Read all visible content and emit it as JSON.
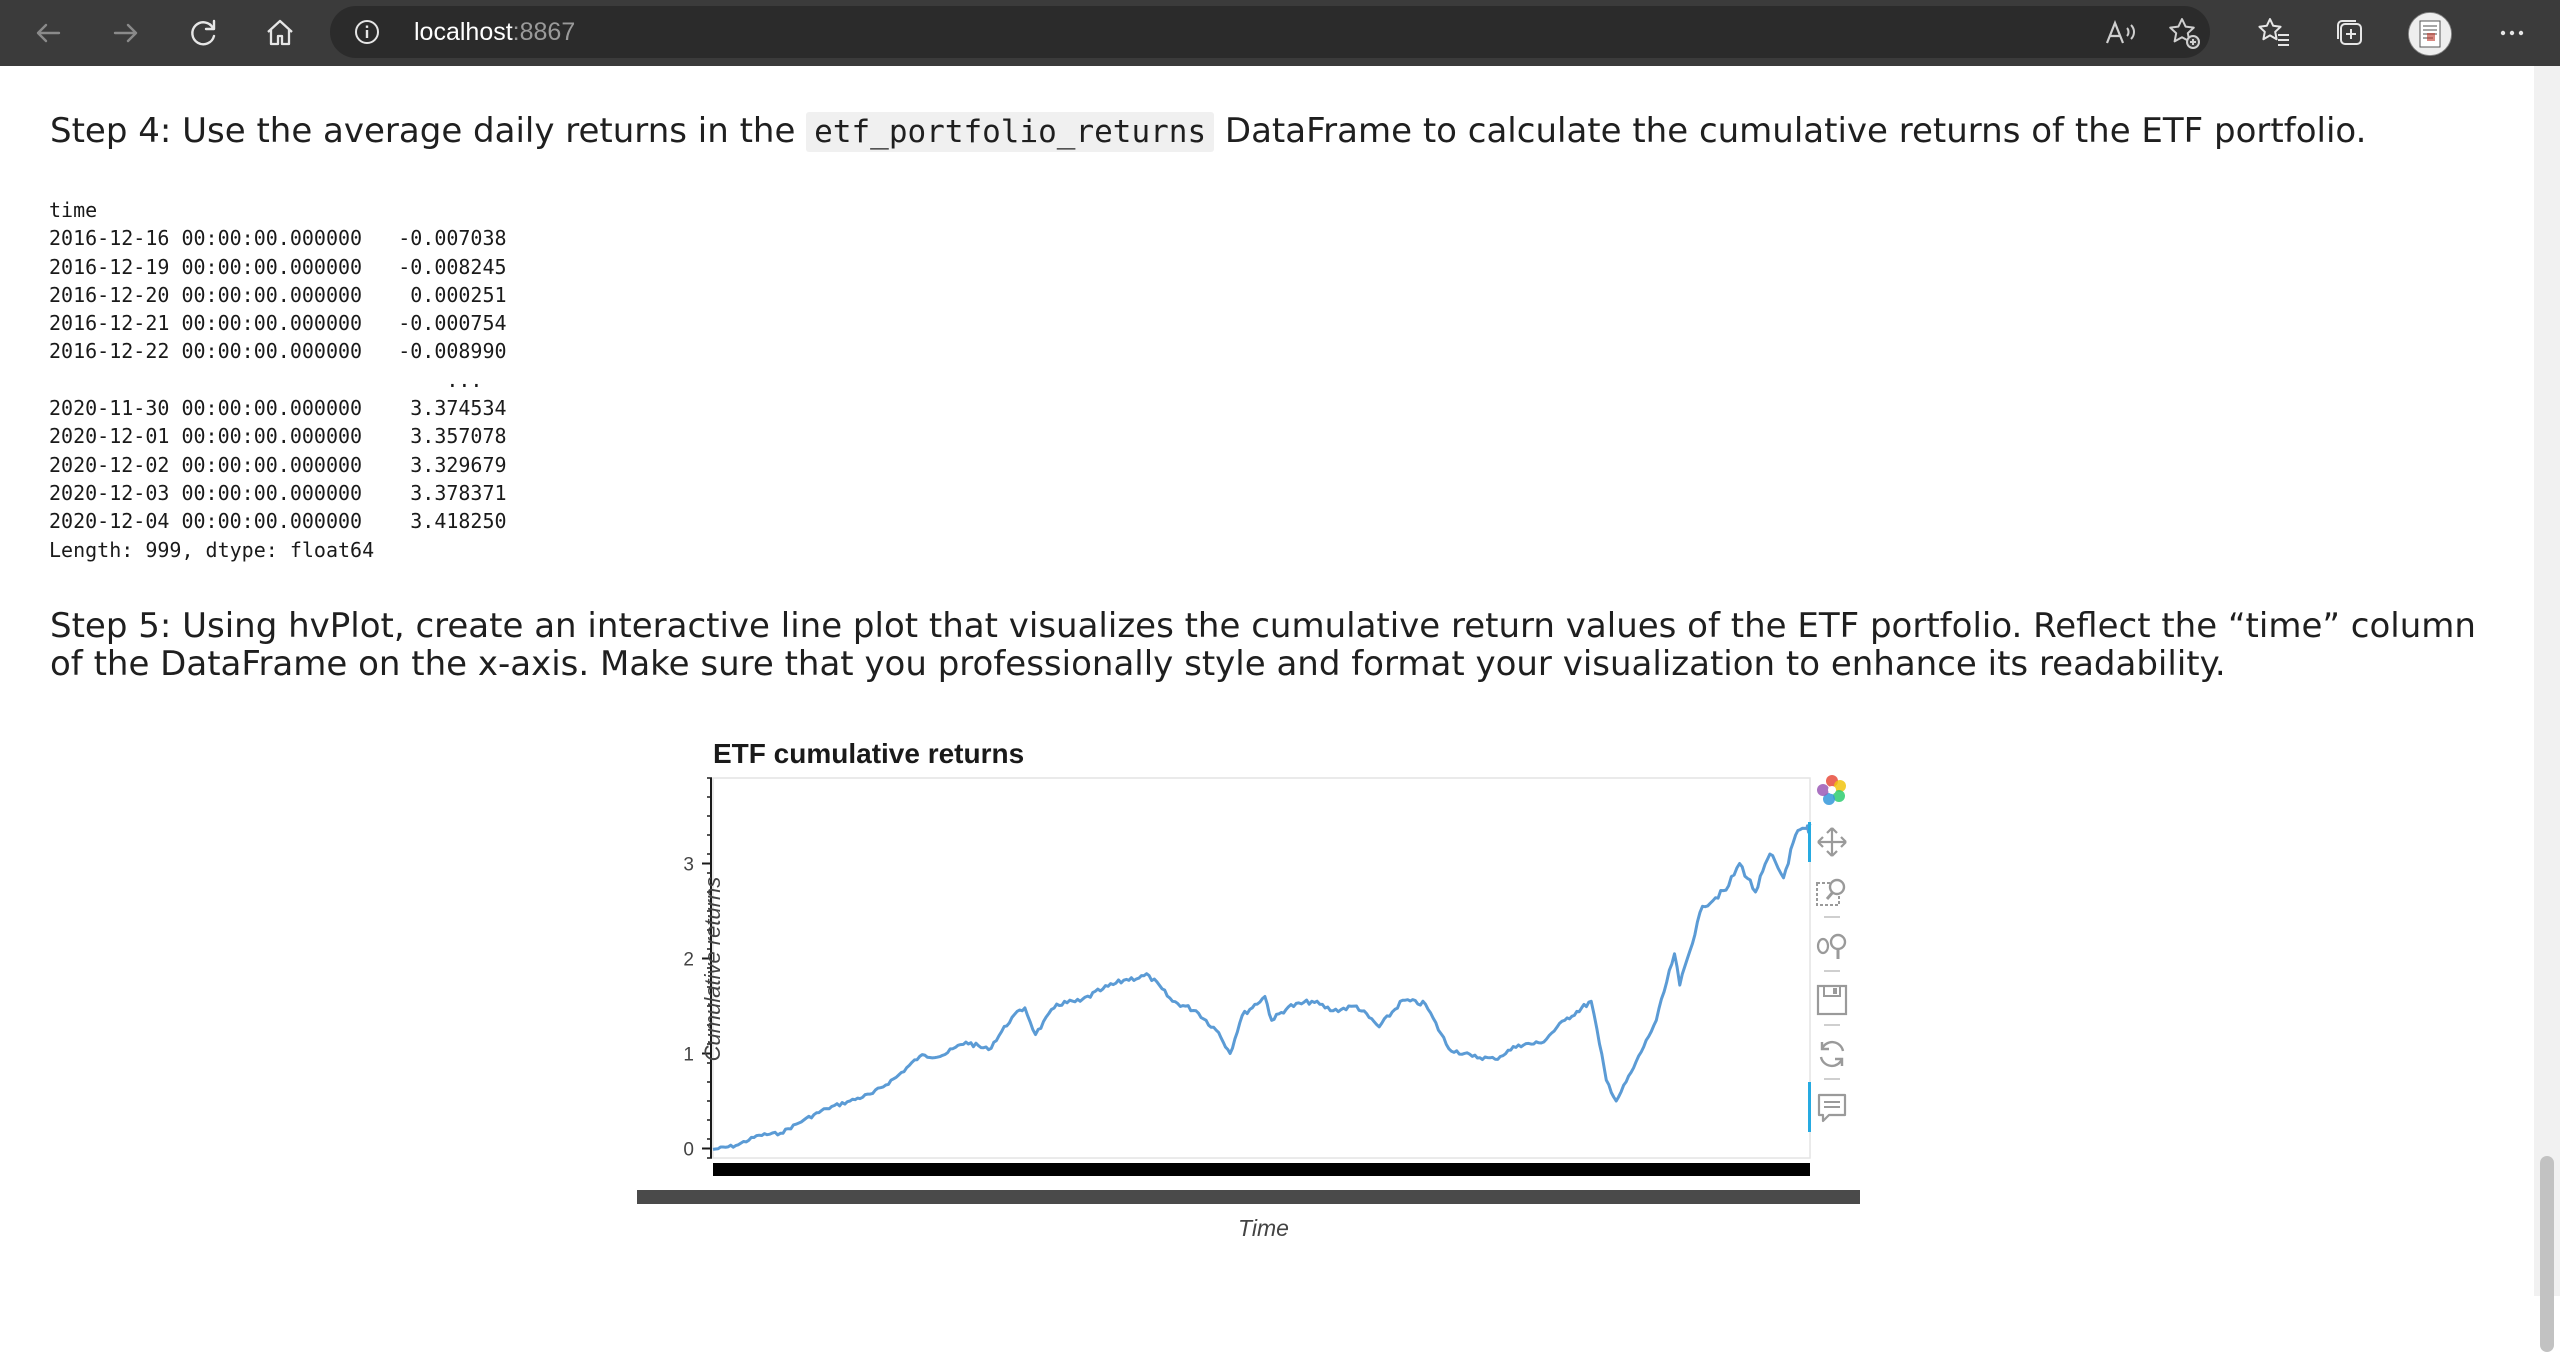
{
  "browser": {
    "address_host": "localhost",
    "address_port": ":8867",
    "icons": [
      "back-icon",
      "forward-icon",
      "refresh-icon",
      "home-icon",
      "info-icon",
      "read-aloud-icon",
      "add-favorite-icon",
      "favorites-icon",
      "collections-icon",
      "profile-avatar",
      "more-icon"
    ]
  },
  "notebook": {
    "step4_prefix": "Step 4: Use the average daily returns in the ",
    "step4_code": "etf_portfolio_returns",
    "step4_suffix": " DataFrame to calculate the cumulative returns of the ETF portfolio.",
    "output_lines": [
      "time",
      "2016-12-16 00:00:00.000000   -0.007038",
      "2016-12-19 00:00:00.000000   -0.008245",
      "2016-12-20 00:00:00.000000    0.000251",
      "2016-12-21 00:00:00.000000   -0.000754",
      "2016-12-22 00:00:00.000000   -0.008990",
      "                                 ...",
      "2020-11-30 00:00:00.000000    3.374534",
      "2020-12-01 00:00:00.000000    3.357078",
      "2020-12-02 00:00:00.000000    3.329679",
      "2020-12-03 00:00:00.000000    3.378371",
      "2020-12-04 00:00:00.000000    3.418250",
      "Length: 999, dtype: float64"
    ],
    "step5_text": "Step 5: Using hvPlot, create an interactive line plot that visualizes the cumulative return values of the ETF portfolio. Reflect the “time” column of the DataFrame on the x-axis. Make sure that you professionally style and format your visualization to enhance its readability."
  },
  "plot": {
    "toolbar_icons": [
      "bokeh-logo-icon",
      "pan-icon",
      "box-zoom-icon",
      "wheel-zoom-icon",
      "save-icon",
      "reset-icon",
      "hover-icon"
    ],
    "line_color": "#5b9bd5"
  },
  "chart_data": {
    "type": "line",
    "title": "ETF cumulative returns",
    "xlabel": "Time",
    "ylabel": "Cumulative returns",
    "x_range": [
      "2016-12-16",
      "2020-12-04"
    ],
    "ylim": [
      -0.1,
      3.9
    ],
    "yticks": [
      0,
      1,
      2,
      3
    ],
    "grid": false,
    "series": [
      {
        "x": [
          "2016-12-16",
          "2017-01-15",
          "2017-02-15",
          "2017-03-15",
          "2017-04-15",
          "2017-05-15",
          "2017-06-15",
          "2017-07-15",
          "2017-08-15",
          "2017-09-15",
          "2017-10-15",
          "2017-11-15",
          "2017-12-15",
          "2018-01-15",
          "2018-02-01",
          "2018-02-15",
          "2018-03-15",
          "2018-04-15",
          "2018-05-15",
          "2018-06-15",
          "2018-07-15",
          "2018-08-15",
          "2018-09-15",
          "2018-10-15",
          "2018-10-30",
          "2018-11-15",
          "2018-12-15",
          "2018-12-24",
          "2019-01-15",
          "2019-02-15",
          "2019-03-15",
          "2019-04-15",
          "2019-05-15",
          "2019-06-15",
          "2019-07-15",
          "2019-08-15",
          "2019-09-15",
          "2019-10-15",
          "2019-11-15",
          "2019-12-15",
          "2020-01-15",
          "2020-02-19",
          "2020-03-01",
          "2020-03-10",
          "2020-03-23",
          "2020-04-15",
          "2020-05-15",
          "2020-06-08",
          "2020-06-15",
          "2020-07-15",
          "2020-08-15",
          "2020-09-02",
          "2020-09-23",
          "2020-10-12",
          "2020-10-30",
          "2020-11-15",
          "2020-11-30",
          "2020-12-01",
          "2020-12-02",
          "2020-12-03",
          "2020-12-04"
        ],
        "y": [
          -0.01,
          0.03,
          0.14,
          0.16,
          0.3,
          0.42,
          0.5,
          0.58,
          0.75,
          0.97,
          0.98,
          1.12,
          1.04,
          1.38,
          1.48,
          1.2,
          1.52,
          1.55,
          1.68,
          1.78,
          1.82,
          1.55,
          1.45,
          1.22,
          1.0,
          1.4,
          1.6,
          1.35,
          1.49,
          1.55,
          1.45,
          1.5,
          1.28,
          1.56,
          1.52,
          1.05,
          0.97,
          0.94,
          1.09,
          1.11,
          1.35,
          1.55,
          1.1,
          0.72,
          0.5,
          0.85,
          1.35,
          2.05,
          1.72,
          2.55,
          2.72,
          3.0,
          2.7,
          3.1,
          2.85,
          3.3,
          3.37,
          3.36,
          3.33,
          3.38,
          3.42
        ]
      }
    ]
  }
}
